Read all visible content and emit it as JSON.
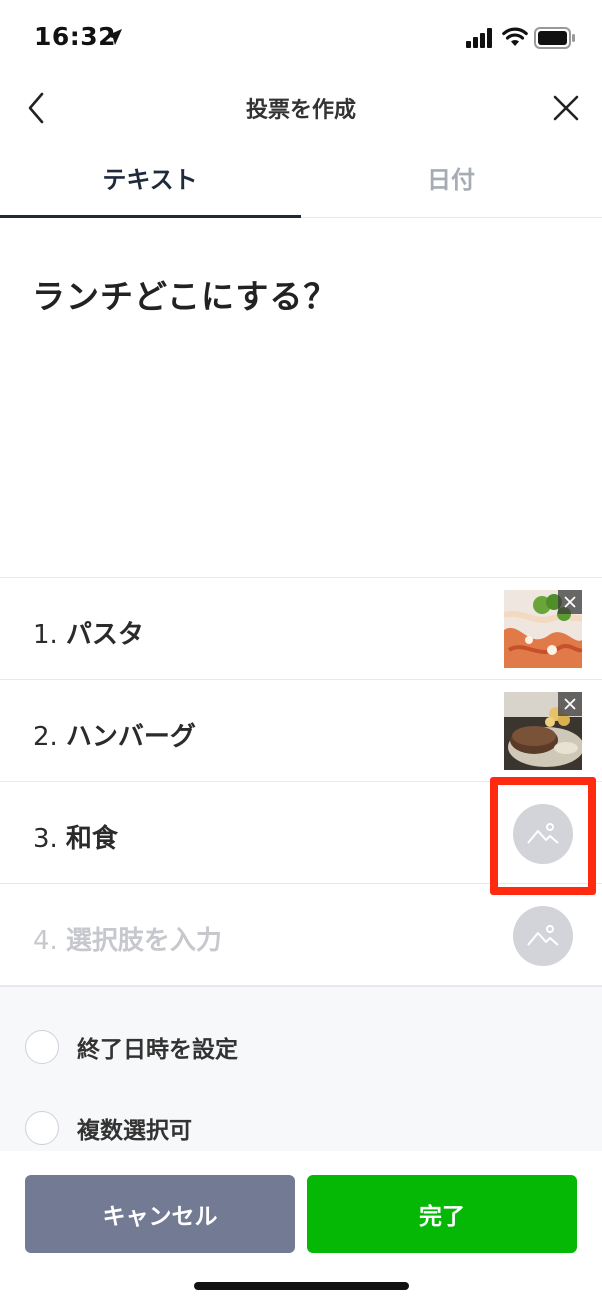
{
  "status_bar": {
    "time": "16:32",
    "location_icon": "location-arrow-icon",
    "signal_icon": "cellular-signal-icon",
    "wifi_icon": "wifi-icon",
    "battery_icon": "battery-icon"
  },
  "nav": {
    "title": "投票を作成",
    "back_icon": "chevron-left-icon",
    "close_icon": "close-icon"
  },
  "tabs": [
    {
      "label": "テキスト",
      "selected": true
    },
    {
      "label": "日付",
      "selected": false
    }
  ],
  "question": "ランチどこにする？",
  "options": [
    {
      "number": "1.",
      "label": "パスタ",
      "has_image": true,
      "image_desc": "pasta photo"
    },
    {
      "number": "2.",
      "label": "ハンバーグ",
      "has_image": true,
      "image_desc": "hamburg steak photo"
    },
    {
      "number": "3.",
      "label": "和食",
      "has_image": false
    },
    {
      "number": "4.",
      "placeholder": "選択肢を入力",
      "has_image": false
    }
  ],
  "settings": [
    {
      "label": "終了日時を設定",
      "checked": false
    },
    {
      "label": "複数選択可",
      "checked": false
    }
  ],
  "buttons": {
    "cancel": "キャンセル",
    "done": "完了"
  },
  "colors": {
    "accent": "#06b806",
    "cancel": "#737a93",
    "tab_active": "#1f2a3d",
    "highlight": "#ff2a10"
  }
}
